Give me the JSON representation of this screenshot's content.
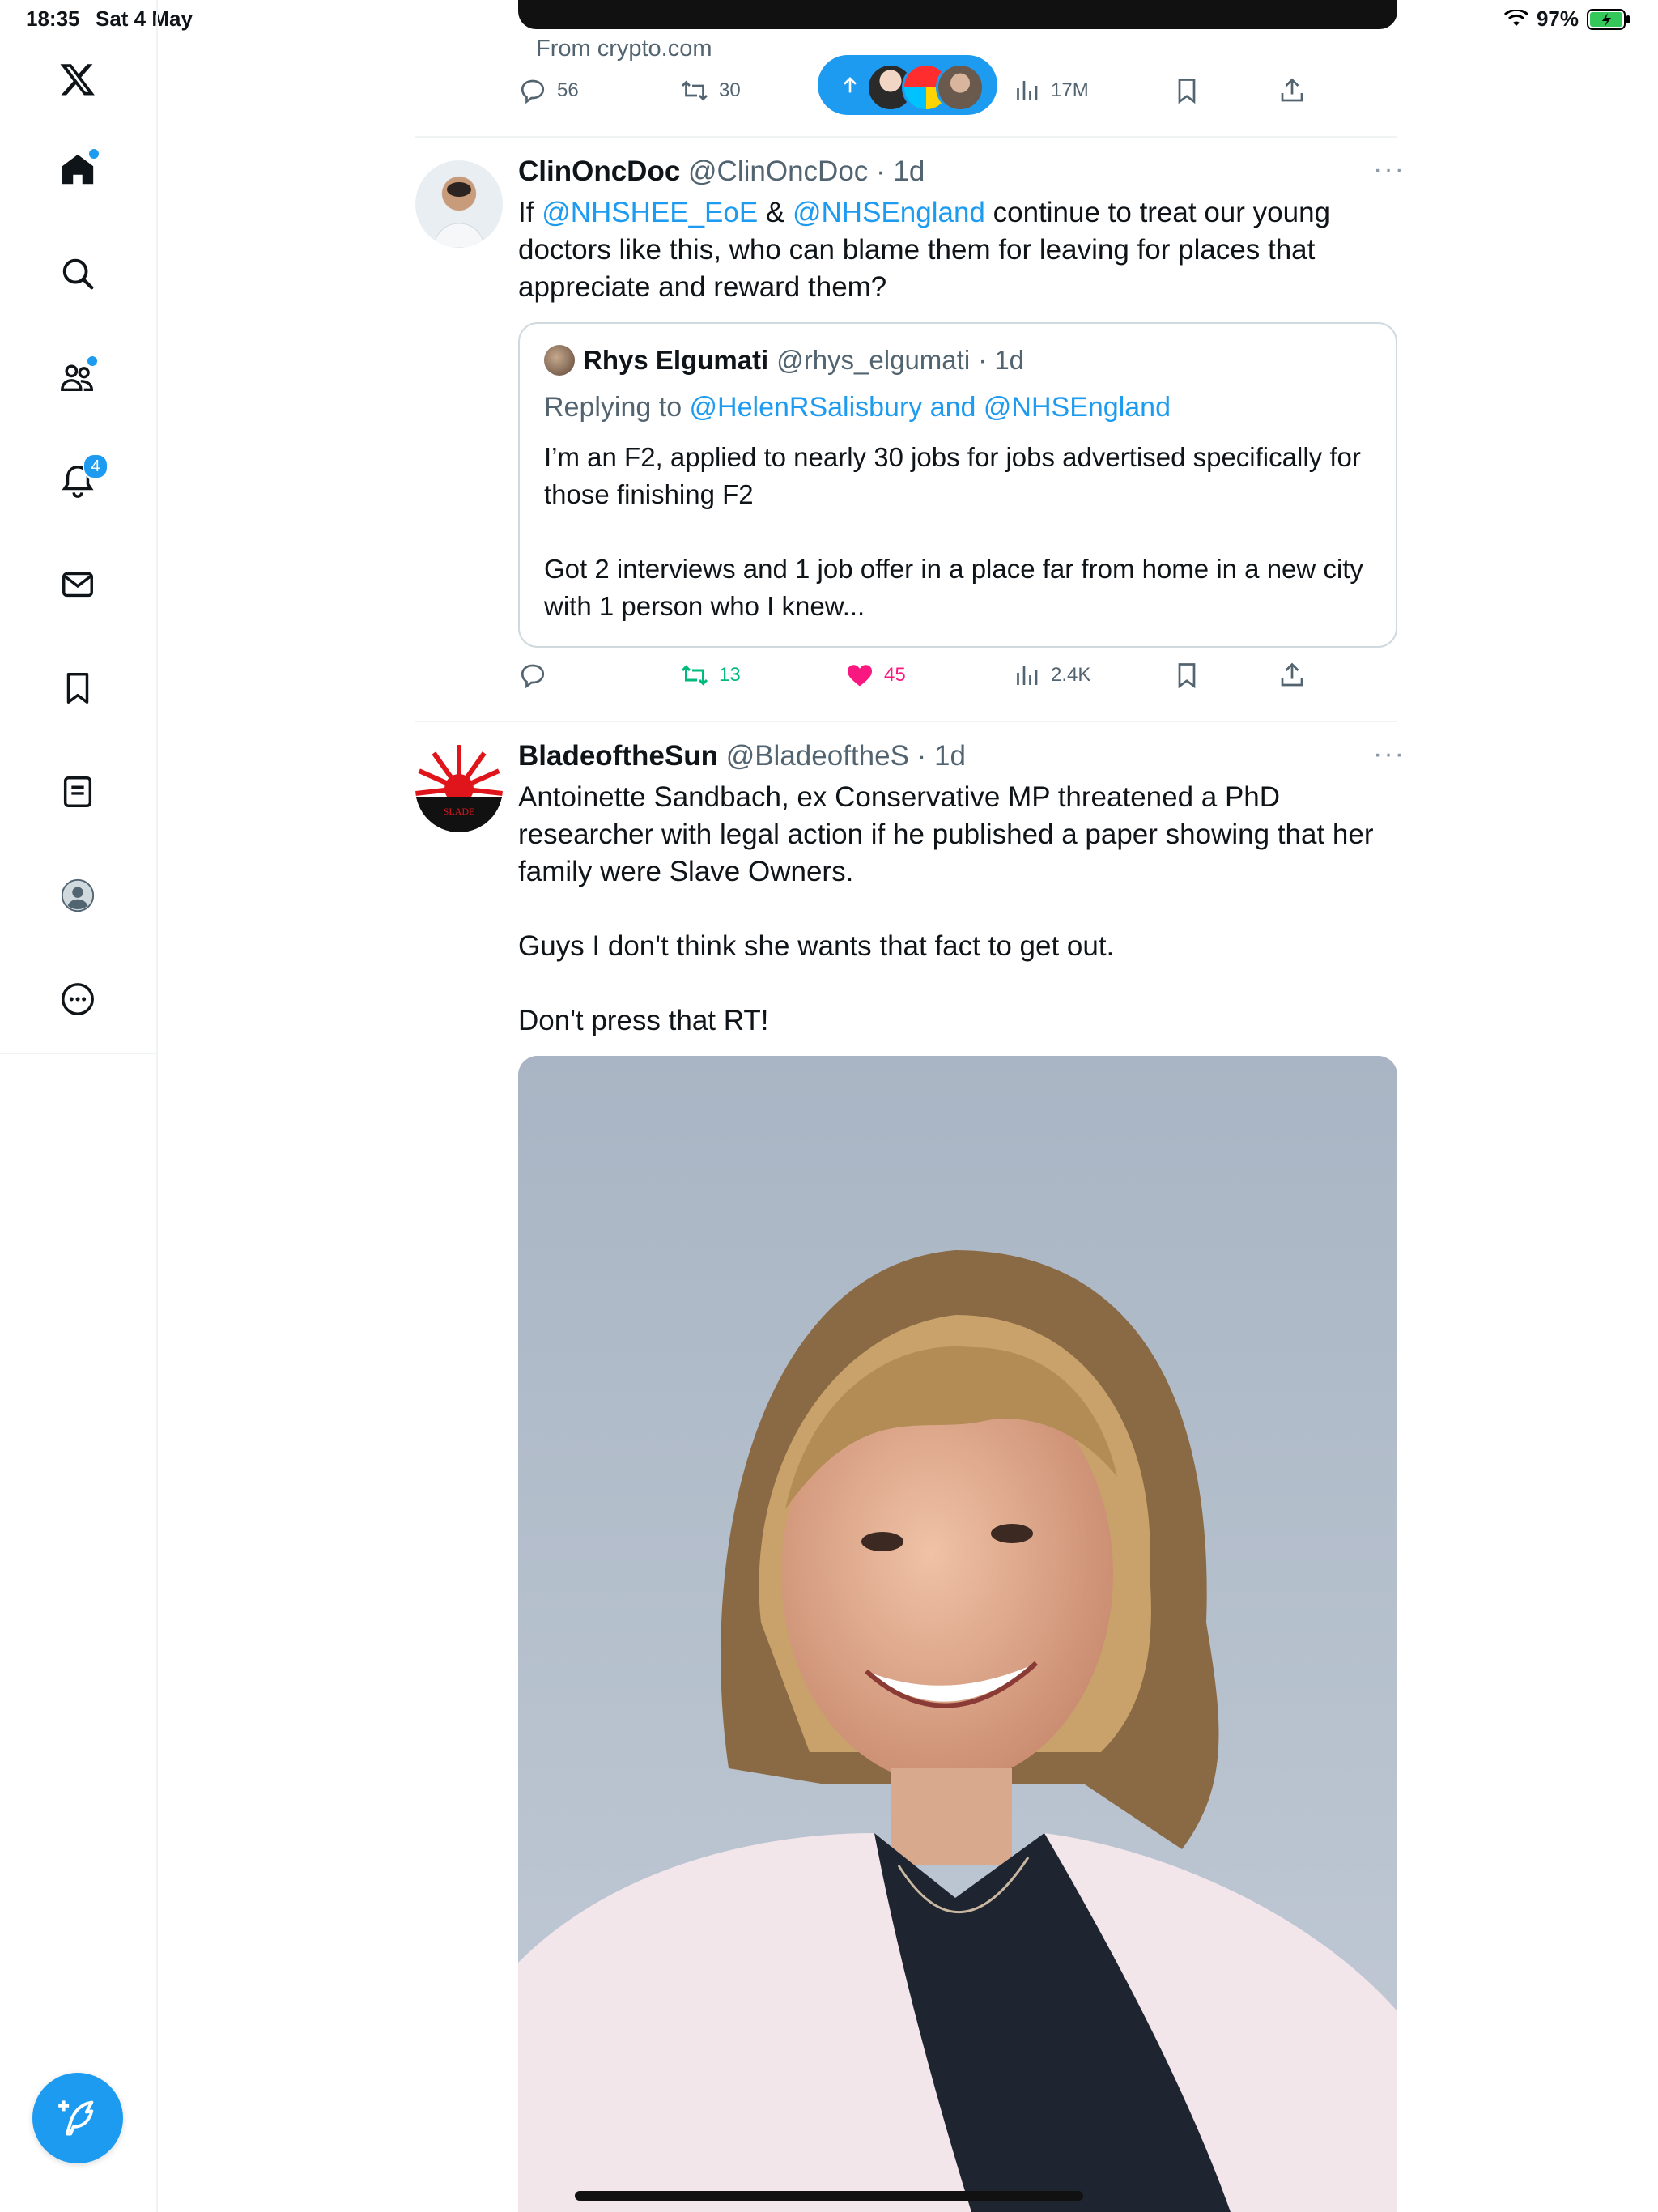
{
  "status_bar": {
    "time": "18:35",
    "date": "Sat 4 May",
    "battery": "97%"
  },
  "sidebar": {
    "items": [
      {
        "name": "home",
        "dot": true
      },
      {
        "name": "explore"
      },
      {
        "name": "communities",
        "dot": true
      },
      {
        "name": "notifications",
        "badge": "4"
      },
      {
        "name": "messages"
      },
      {
        "name": "bookmarks"
      },
      {
        "name": "lists"
      },
      {
        "name": "profile"
      },
      {
        "name": "more"
      }
    ],
    "notifications_badge": "4"
  },
  "ad_tweet": {
    "from_label": "From crypto.com",
    "replies": "56",
    "retweets": "30",
    "views": "17M"
  },
  "tweet1": {
    "name": "ClinOncDoc",
    "handle": "@ClinOncDoc",
    "time": "· 1d",
    "text_prefix": "If ",
    "mention1": "@NHSHEE_EoE",
    "amp": " & ",
    "mention2": "@NHSEngland",
    "text_rest": " continue to treat our young doctors like this, who can blame them for leaving for places that appreciate and reward them?",
    "quote": {
      "name": "Rhys Elgumati",
      "handle": "@rhys_elgumati",
      "time": "· 1d",
      "replying_prefix": "Replying to ",
      "replying_to": "@HelenRSalisbury and @NHSEngland",
      "text_line1": "I’m an F2, applied to nearly 30 jobs for jobs advertised specifically for those finishing F2",
      "text_line2": "Got 2 interviews and 1 job offer in a place far from home in a new city with 1 person who I knew..."
    },
    "retweets": "13",
    "likes": "45",
    "views": "2.4K"
  },
  "tweet2": {
    "name": "BladeoftheSun",
    "handle": "@BladeoftheS",
    "time": "· 1d",
    "para1": "Antoinette Sandbach, ex Conservative MP threatened a PhD researcher with legal action if he published a paper showing that her family were Slave Owners.",
    "para2": "Guys I don't think she wants that fact to get out.",
    "para3": "Don't press that RT!"
  },
  "colors": {
    "accent": "#1d9bf0",
    "retweet": "#00ba7c",
    "like": "#f91880",
    "muted": "#536471"
  }
}
